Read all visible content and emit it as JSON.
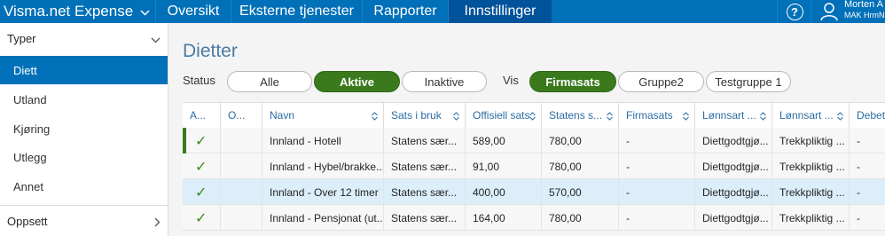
{
  "app": {
    "title": "Visma.net Expense"
  },
  "nav": {
    "tabs": [
      {
        "label": "Oversikt",
        "active": false
      },
      {
        "label": "Eksterne tjenester",
        "active": false
      },
      {
        "label": "Rapporter",
        "active": false
      },
      {
        "label": "Innstillinger",
        "active": true
      }
    ]
  },
  "user": {
    "name": "Morten A",
    "sub": "MAK HrmN"
  },
  "sidebar": {
    "section_label": "Typer",
    "items": [
      {
        "label": "Diett",
        "active": true
      },
      {
        "label": "Utland",
        "active": false
      },
      {
        "label": "Kjøring",
        "active": false
      },
      {
        "label": "Utlegg",
        "active": false
      },
      {
        "label": "Annet",
        "active": false
      }
    ],
    "footer_label": "Oppsett"
  },
  "page": {
    "title": "Dietter"
  },
  "filters": {
    "status_label": "Status",
    "status_options": [
      {
        "label": "Alle",
        "active": false
      },
      {
        "label": "Aktive",
        "active": true
      },
      {
        "label": "Inaktive",
        "active": false
      }
    ],
    "vis_label": "Vis",
    "vis_options": [
      {
        "label": "Firmasats",
        "active": true
      },
      {
        "label": "Gruppe2",
        "active": false
      },
      {
        "label": "Testgruppe 1",
        "active": false
      }
    ]
  },
  "table": {
    "columns": [
      "A...",
      "O...",
      "Navn",
      "Sats i bruk",
      "Offisiell sats",
      "Statens s...",
      "Firmasats",
      "Lønnsart ...",
      "Lønnsart ...",
      "Debet"
    ],
    "rows": [
      {
        "active": true,
        "name": "Innland - Hotell",
        "sats": "Statens sær...",
        "offisiell": "589,00",
        "statens": "780,00",
        "firma": "-",
        "lonn1": "Diettgodtgjø...",
        "lonn2": "Trekkpliktig ...",
        "debet": "-"
      },
      {
        "active": true,
        "name": "Innland - Hybel/brakke...",
        "sats": "Statens sær...",
        "offisiell": "91,00",
        "statens": "780,00",
        "firma": "-",
        "lonn1": "Diettgodtgjø...",
        "lonn2": "Trekkpliktig ...",
        "debet": "-"
      },
      {
        "active": true,
        "name": "Innland - Over 12 timer",
        "sats": "Statens sær...",
        "offisiell": "400,00",
        "statens": "570,00",
        "firma": "-",
        "lonn1": "Diettgodtgjø...",
        "lonn2": "Trekkpliktig ...",
        "debet": "-"
      },
      {
        "active": true,
        "name": "Innland - Pensjonat (ut...",
        "sats": "Statens sær...",
        "offisiell": "164,00",
        "statens": "780,00",
        "firma": "-",
        "lonn1": "Diettgodtgjø...",
        "lonn2": "Trekkpliktig ...",
        "debet": "-"
      }
    ]
  },
  "icons": {
    "check": "check-icon",
    "sort": "sort-icon",
    "help": "help-icon",
    "user": "user-icon",
    "chevron": "chevron-icon"
  },
  "colors": {
    "topbar": "#0070b8",
    "active_tab": "#00539a",
    "pill_on": "#3a7a1d",
    "row_highlight": "#dbeefa"
  }
}
